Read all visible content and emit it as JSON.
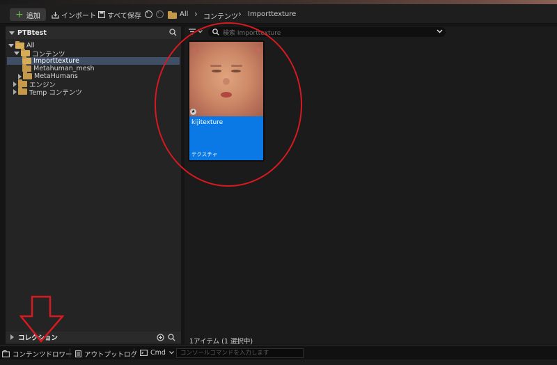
{
  "toolbar": {
    "add_label": "追加",
    "import_label": "インポート",
    "save_all_label": "すべて保存",
    "breadcrumb": [
      "All",
      "コンテンツ",
      "Importtexture"
    ]
  },
  "sources_panel": {
    "title": "PTBtest",
    "tree": [
      {
        "label": "All",
        "level": 0,
        "expanded": true,
        "selected": false
      },
      {
        "label": "コンテンツ",
        "level": 1,
        "expanded": true,
        "selected": false
      },
      {
        "label": "Importtexture",
        "level": 2,
        "expanded": false,
        "selected": true
      },
      {
        "label": "Metahuman_mesh",
        "level": 2,
        "expanded": false,
        "selected": false
      },
      {
        "label": "MetaHumans",
        "level": 2,
        "expanded": false,
        "selected": false
      },
      {
        "label": "エンジン",
        "level": 1,
        "expanded": false,
        "selected": false
      },
      {
        "label": "Temp コンテンツ",
        "level": 1,
        "expanded": false,
        "selected": false
      }
    ],
    "collections_label": "コレクション"
  },
  "content": {
    "search_placeholder": "検索 Importtexture",
    "asset": {
      "name": "kijitexture",
      "type": "テクスチャ"
    },
    "status": "1アイテム (1 選択中)"
  },
  "bottombar": {
    "content_drawer": "コンテンツドロワー",
    "output_log": "アウトプットログ",
    "cmd": "Cmd",
    "console_placeholder": "コンソールコマンドを入力します"
  },
  "colors": {
    "accent_selected": "#0a79e6",
    "tree_selected": "#3e4f66",
    "annotation": "#d71920",
    "folder": "#c49a4a"
  }
}
